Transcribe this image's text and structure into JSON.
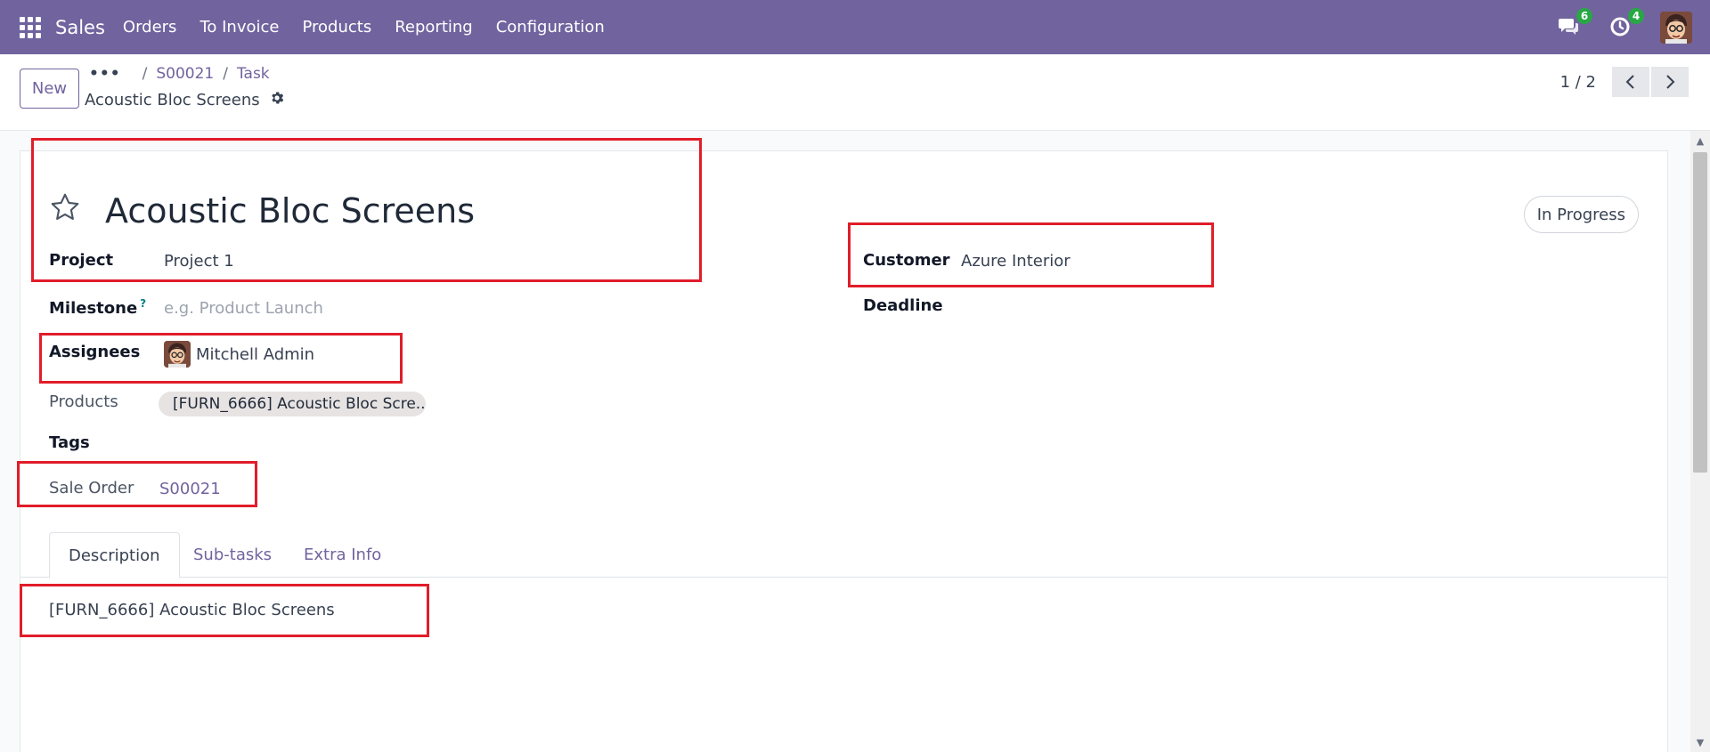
{
  "navbar": {
    "app_name": "Sales",
    "menu": [
      "Orders",
      "To Invoice",
      "Products",
      "Reporting",
      "Configuration"
    ],
    "messages_count": "6",
    "activities_count": "4",
    "background": "#71639e"
  },
  "control_panel": {
    "new_label": "New",
    "breadcrumb": {
      "ellipsis": "•••",
      "sep1": "/",
      "order": "S00021",
      "sep2": "/",
      "task": "Task"
    },
    "record_title": "Acoustic Bloc Screens",
    "pager": "1 / 2"
  },
  "form": {
    "title": "Acoustic Bloc Screens",
    "status": "In Progress",
    "fields": {
      "project": {
        "label": "Project",
        "value": "Project 1"
      },
      "milestone": {
        "label": "Milestone",
        "help": "?",
        "placeholder": "e.g. Product Launch"
      },
      "assignees": {
        "label": "Assignees",
        "value": "Mitchell Admin"
      },
      "products": {
        "label": "Products",
        "value": "[FURN_6666] Acoustic Bloc Scre..."
      },
      "tags": {
        "label": "Tags"
      },
      "sale_order": {
        "label": "Sale Order",
        "value": "S00021"
      },
      "customer": {
        "label": "Customer",
        "value": "Azure Interior"
      },
      "deadline": {
        "label": "Deadline"
      }
    }
  },
  "tabs": [
    "Description",
    "Sub-tasks",
    "Extra Info"
  ],
  "description": "[FURN_6666] Acoustic Bloc Screens",
  "icons": {
    "apps": "apps-grid-icon",
    "messages": "chat-bubbles-icon",
    "activities": "clock-activity-icon",
    "settings": "gear-icon",
    "favorite": "star-outline-icon"
  }
}
